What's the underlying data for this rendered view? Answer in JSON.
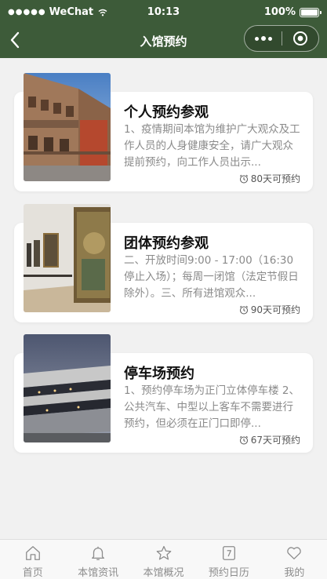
{
  "status_bar": {
    "carrier": "WeChat",
    "time": "10:13",
    "battery": "100%"
  },
  "nav": {
    "title": "入馆预约"
  },
  "cards": [
    {
      "title": "个人预约参观",
      "desc": "1、疫情期间本馆为维护广大观众及工作人员的人身健康安全，请广大观众提前预约，向工作人员出示...",
      "days": "80天可预约"
    },
    {
      "title": "团体预约参观",
      "desc": "二、开放时间9:00 - 17:00（16:30停止入场）；每周一闭馆（法定节假日除外）。三、所有进馆观众...",
      "days": "90天可预约"
    },
    {
      "title": "停车场预约",
      "desc": "1、预约停车场为正门立体停车楼 2、公共汽车、中型以上客车不需要进行预约，但必须在正门口即停...",
      "days": "67天可预约"
    }
  ],
  "tabbar": [
    {
      "label": "首页",
      "icon": "home-icon"
    },
    {
      "label": "本馆资讯",
      "icon": "bell-icon"
    },
    {
      "label": "本馆概况",
      "icon": "star-icon"
    },
    {
      "label": "预约日历",
      "icon": "calendar-icon"
    },
    {
      "label": "我的",
      "icon": "heart-icon"
    }
  ],
  "colors": {
    "nav_bg": "#3d5b39",
    "page_bg": "#f1f1f1",
    "tab_text": "#8c8c8c"
  }
}
